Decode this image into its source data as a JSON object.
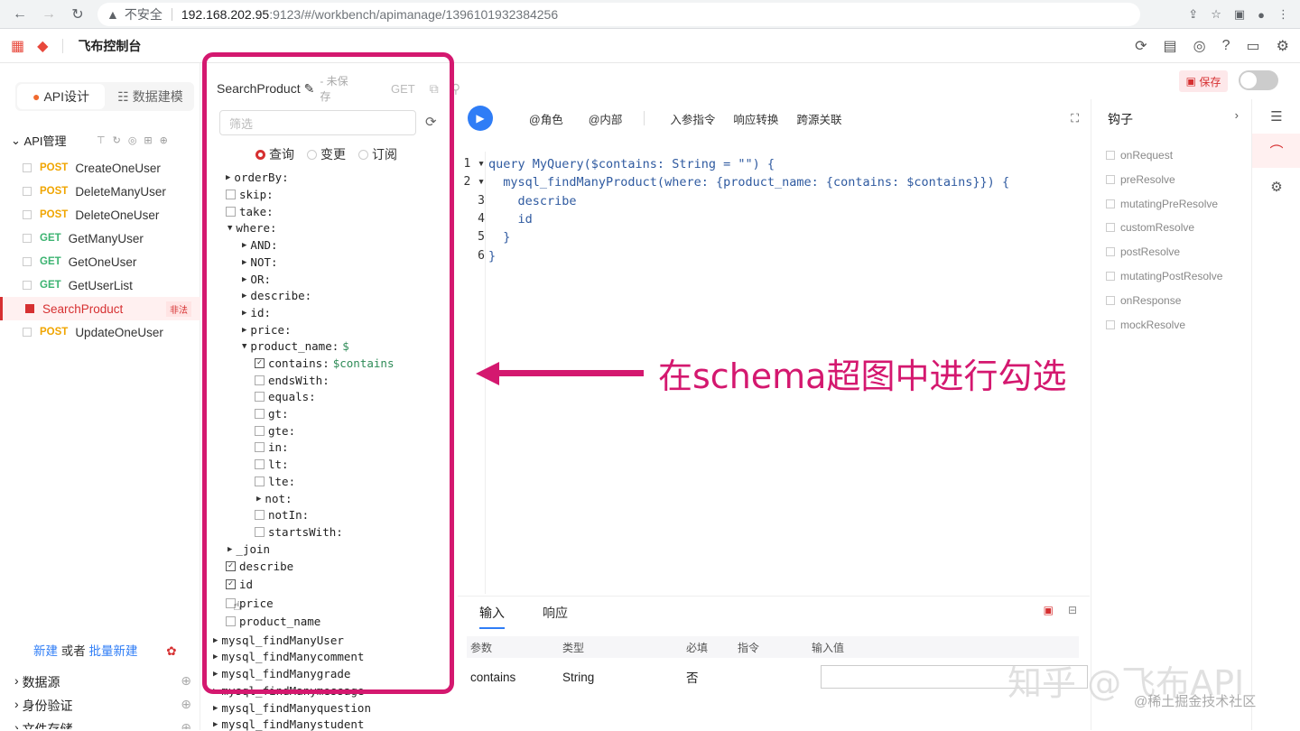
{
  "browser": {
    "insecure": "不安全",
    "host": "192.168.202.95",
    "path": ":9123/#/workbench/apimanage/1396101932384256"
  },
  "app": {
    "title": "飞布控制台"
  },
  "left_tabs": {
    "api": "API设计",
    "data": "数据建模"
  },
  "api_section": {
    "title": "API管理"
  },
  "api_items": [
    {
      "method": "POST",
      "name": "CreateOneUser"
    },
    {
      "method": "POST",
      "name": "DeleteManyUser"
    },
    {
      "method": "POST",
      "name": "DeleteOneUser"
    },
    {
      "method": "GET",
      "name": "GetManyUser"
    },
    {
      "method": "GET",
      "name": "GetOneUser"
    },
    {
      "method": "GET",
      "name": "GetUserList"
    },
    {
      "method": "",
      "name": "SearchProduct",
      "badge": "非法"
    },
    {
      "method": "POST",
      "name": "UpdateOneUser"
    }
  ],
  "new_row": {
    "new": "新建",
    "or": "或者",
    "batch": "批量新建"
  },
  "bottom_sections": {
    "datasource": "数据源",
    "auth": "身份验证",
    "file": "文件存储"
  },
  "mid": {
    "title": "SearchProduct",
    "unsaved": "- 未保存",
    "method": "GET",
    "filter_placeholder": "筛选",
    "radio_query": "查询",
    "radio_mutation": "变更",
    "radio_subscribe": "订阅"
  },
  "tree": [
    "orderBy:",
    "skip:",
    "take:",
    "where:",
    "AND:",
    "NOT:",
    "OR:",
    "describe:",
    "id:",
    "price:",
    "product_name:",
    "$",
    "contains:",
    "$contains",
    "endsWith:",
    "equals:",
    "gt:",
    "gte:",
    "in:",
    "lt:",
    "lte:",
    "not:",
    "notIn:",
    "startsWith:",
    "_join",
    "describe",
    "id",
    "price",
    "product_name",
    "mysql_findManyUser",
    "mysql_findManycomment",
    "mysql_findManygrade",
    "mysql_findManymessage",
    "mysql_findManyquestion",
    "mysql_findManystudent"
  ],
  "toolbar": {
    "role": "@角色",
    "internal": "@内部",
    "input_dir": "入参指令",
    "resp_conv": "响应转换",
    "cross": "跨源关联"
  },
  "code_lines": [
    "query MyQuery($contains: String = \"\") {",
    "  mysql_findManyProduct(where: {product_name: {contains: $contains}}) {",
    "    describe",
    "    id",
    "  }",
    "}"
  ],
  "annotation": "在schema超图中进行勾选",
  "bottom_panel": {
    "tab_input": "输入",
    "tab_response": "响应",
    "headers": [
      "参数",
      "类型",
      "必填",
      "指令",
      "输入值"
    ],
    "row": {
      "param": "contains",
      "type": "String",
      "required": "否"
    }
  },
  "hooks": {
    "title": "钩子",
    "items": [
      "onRequest",
      "preResolve",
      "mutatingPreResolve",
      "customResolve",
      "postResolve",
      "mutatingPostResolve",
      "onResponse",
      "mockResolve"
    ]
  },
  "save_label": "保存",
  "watermark": "知乎 @飞布API",
  "watermark2": "@稀土掘金技术社区"
}
